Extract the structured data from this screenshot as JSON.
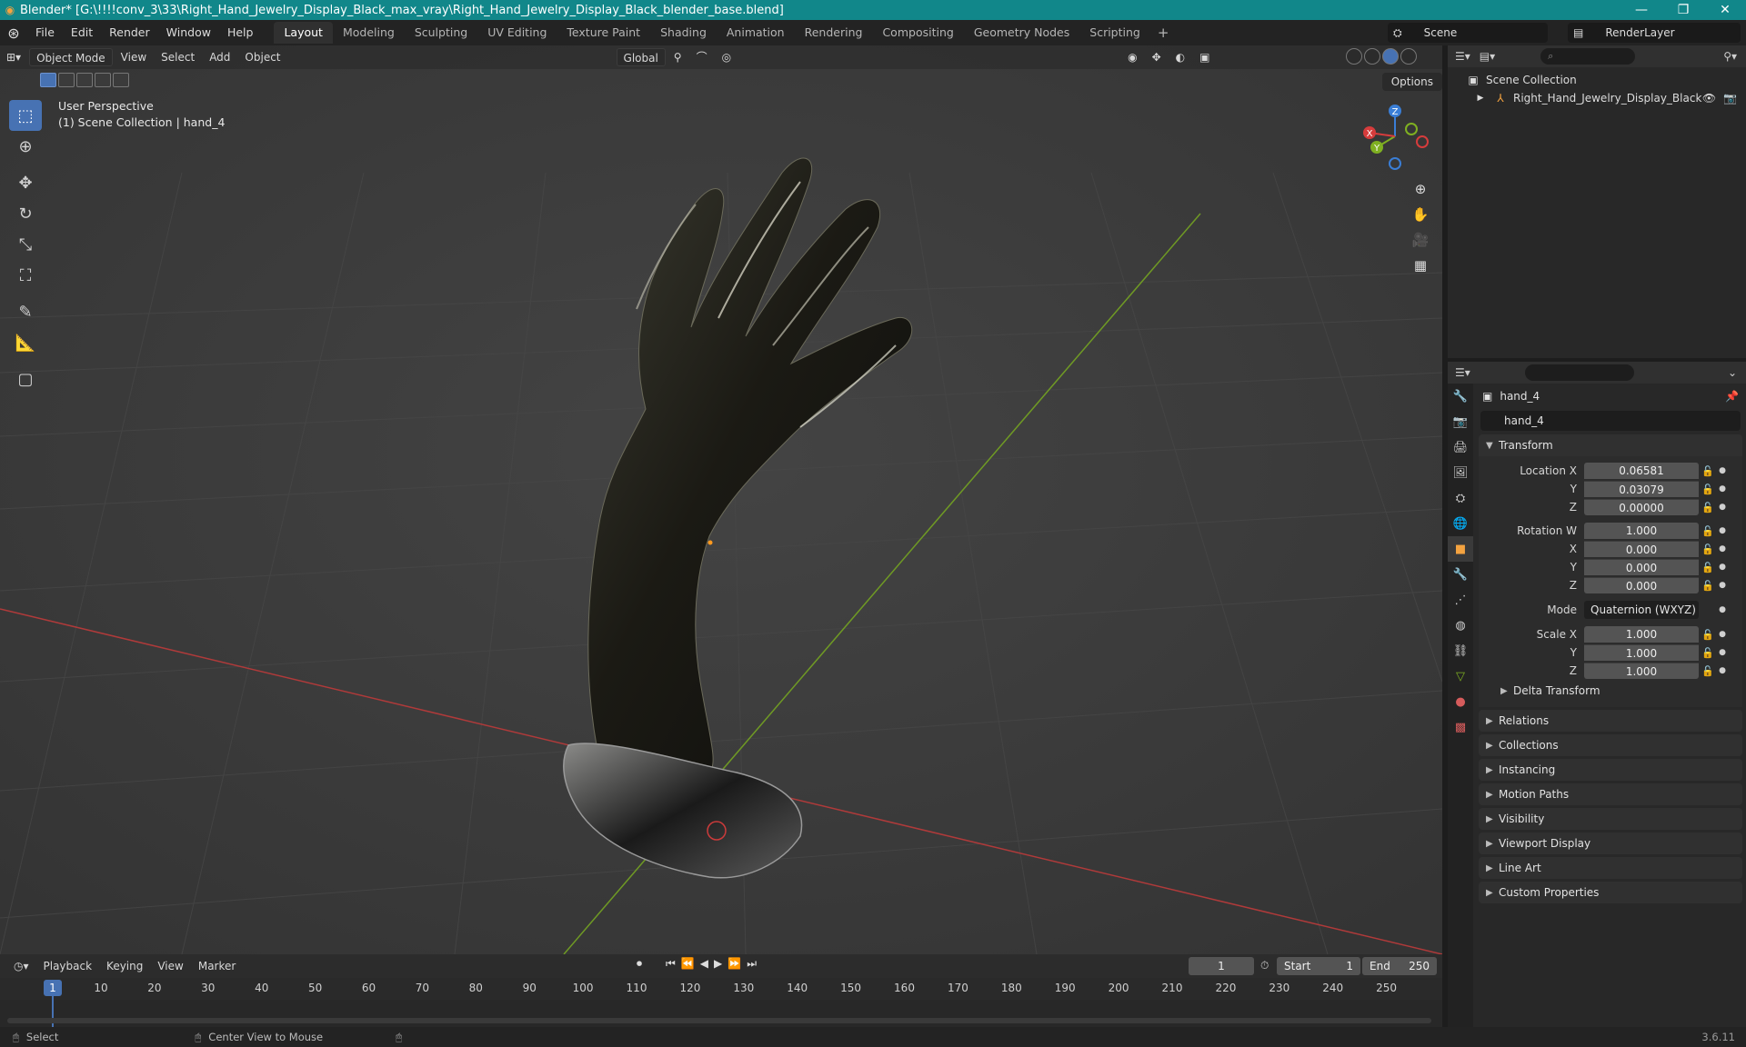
{
  "window": {
    "title": "Blender* [G:\\!!!!conv_3\\33\\Right_Hand_Jewelry_Display_Black_max_vray\\Right_Hand_Jewelry_Display_Black_blender_base.blend]",
    "minimize": "—",
    "maximize": "❐",
    "close": "✕"
  },
  "menu": {
    "items": [
      "File",
      "Edit",
      "Render",
      "Window",
      "Help"
    ]
  },
  "workspaces": {
    "tabs": [
      "Layout",
      "Modeling",
      "Sculpting",
      "UV Editing",
      "Texture Paint",
      "Shading",
      "Animation",
      "Rendering",
      "Compositing",
      "Geometry Nodes",
      "Scripting"
    ],
    "active": "Layout",
    "add": "+"
  },
  "scene": {
    "label": "Scene"
  },
  "render_layer": {
    "label": "RenderLayer"
  },
  "viewport": {
    "mode": "Object Mode",
    "menus": [
      "View",
      "Select",
      "Add",
      "Object"
    ],
    "orientation": "Global",
    "options": "Options",
    "info_line1": "User Perspective",
    "info_line2": "(1) Scene Collection | hand_4",
    "gizmo": {
      "x": "X",
      "y": "Y",
      "z": "Z"
    }
  },
  "outliner": {
    "root": "Scene Collection",
    "item": "Right_Hand_Jewelry_Display_Black"
  },
  "properties": {
    "object_name": "hand_4",
    "data_name": "hand_4",
    "transform": {
      "title": "Transform",
      "location_x_label": "Location X",
      "location_x": "0.06581",
      "location_y_label": "Y",
      "location_y": "0.03079",
      "location_z_label": "Z",
      "location_z": "0.00000",
      "rotation_w_label": "Rotation W",
      "rotation_w": "1.000",
      "rotation_x_label": "X",
      "rotation_x": "0.000",
      "rotation_y_label": "Y",
      "rotation_y": "0.000",
      "rotation_z_label": "Z",
      "rotation_z": "0.000",
      "mode_label": "Mode",
      "mode": "Quaternion (WXYZ)",
      "scale_x_label": "Scale X",
      "scale_x": "1.000",
      "scale_y_label": "Y",
      "scale_y": "1.000",
      "scale_z_label": "Z",
      "scale_z": "1.000",
      "delta": "Delta Transform"
    },
    "panels": [
      "Relations",
      "Collections",
      "Instancing",
      "Motion Paths",
      "Visibility",
      "Viewport Display",
      "Line Art",
      "Custom Properties"
    ]
  },
  "timeline": {
    "menus": [
      "Playback",
      "Keying",
      "View",
      "Marker"
    ],
    "current_frame": "1",
    "start_label": "Start",
    "start": "1",
    "end_label": "End",
    "end": "250",
    "ruler": [
      "1",
      "10",
      "20",
      "30",
      "40",
      "50",
      "60",
      "70",
      "80",
      "90",
      "100",
      "110",
      "120",
      "130",
      "140",
      "150",
      "160",
      "170",
      "180",
      "190",
      "200",
      "210",
      "220",
      "230",
      "240",
      "250"
    ]
  },
  "status": {
    "select": "Select",
    "center": "Center View to Mouse",
    "version": "3.6.11"
  },
  "colors": {
    "titlebar": "#11878a",
    "accent": "#4772b3",
    "x_axis": "#d63c3c",
    "y_axis": "#7fb021",
    "z_axis": "#3a7ed6"
  }
}
